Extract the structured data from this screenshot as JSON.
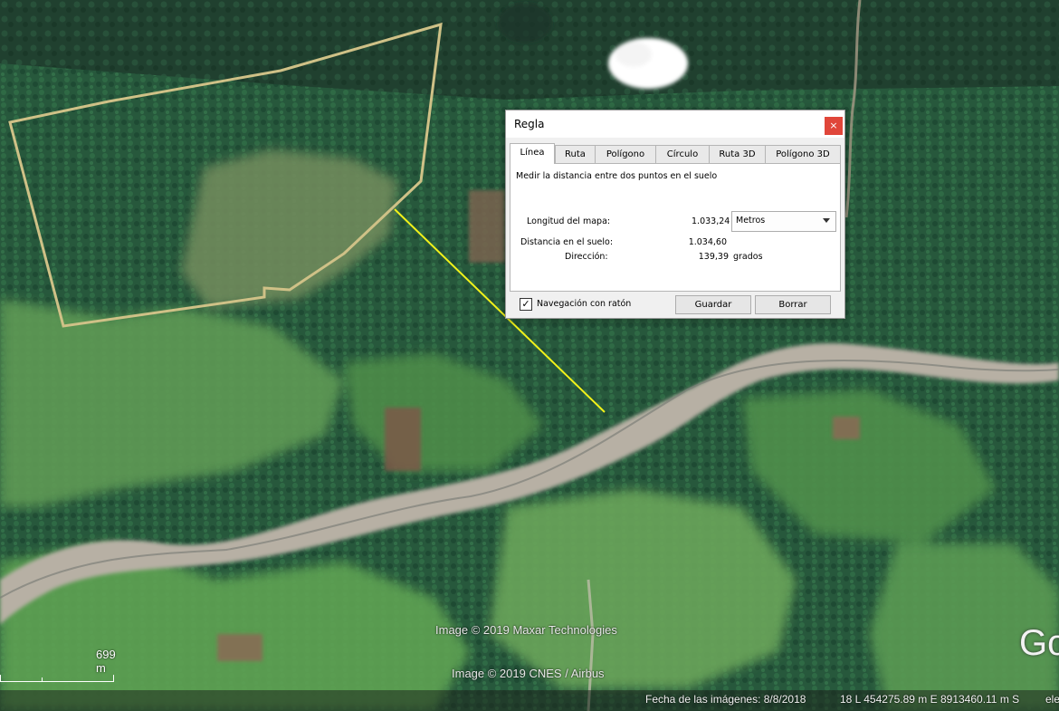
{
  "map": {
    "credits": [
      "Image © 2019 Maxar Technologies",
      "Image © 2019 CNES / Airbus"
    ],
    "scale_label": "699 m",
    "logo_text": "Go",
    "status": {
      "date": "Fecha de las imágenes: 8/8/2018",
      "coords": "18 L 454275.89 m E 8913460.11 m S",
      "elev": "ele"
    },
    "colors": {
      "polygon": "#cfc187",
      "line": "#f2f21a",
      "forest": "#24543a",
      "river": "#b9b2a6"
    }
  },
  "dialog": {
    "title": "Regla",
    "close_glyph": "×",
    "tabs": [
      "Línea",
      "Ruta",
      "Polígono",
      "Círculo",
      "Ruta 3D",
      "Polígono 3D"
    ],
    "active_tab": "Línea",
    "description": "Medir la distancia entre dos puntos en el suelo",
    "map_length_label": "Longitud del mapa:",
    "map_length_value": "1.033,24",
    "unit_selected": "Metros",
    "ground_distance_label": "Distancia en el suelo:",
    "ground_distance_value": "1.034,60",
    "direction_label": "Dirección:",
    "direction_value": "139,39",
    "direction_unit": "grados",
    "mouse_nav_label": "Navegación con ratón",
    "mouse_nav_checked": true,
    "save_label": "Guardar",
    "clear_label": "Borrar"
  }
}
